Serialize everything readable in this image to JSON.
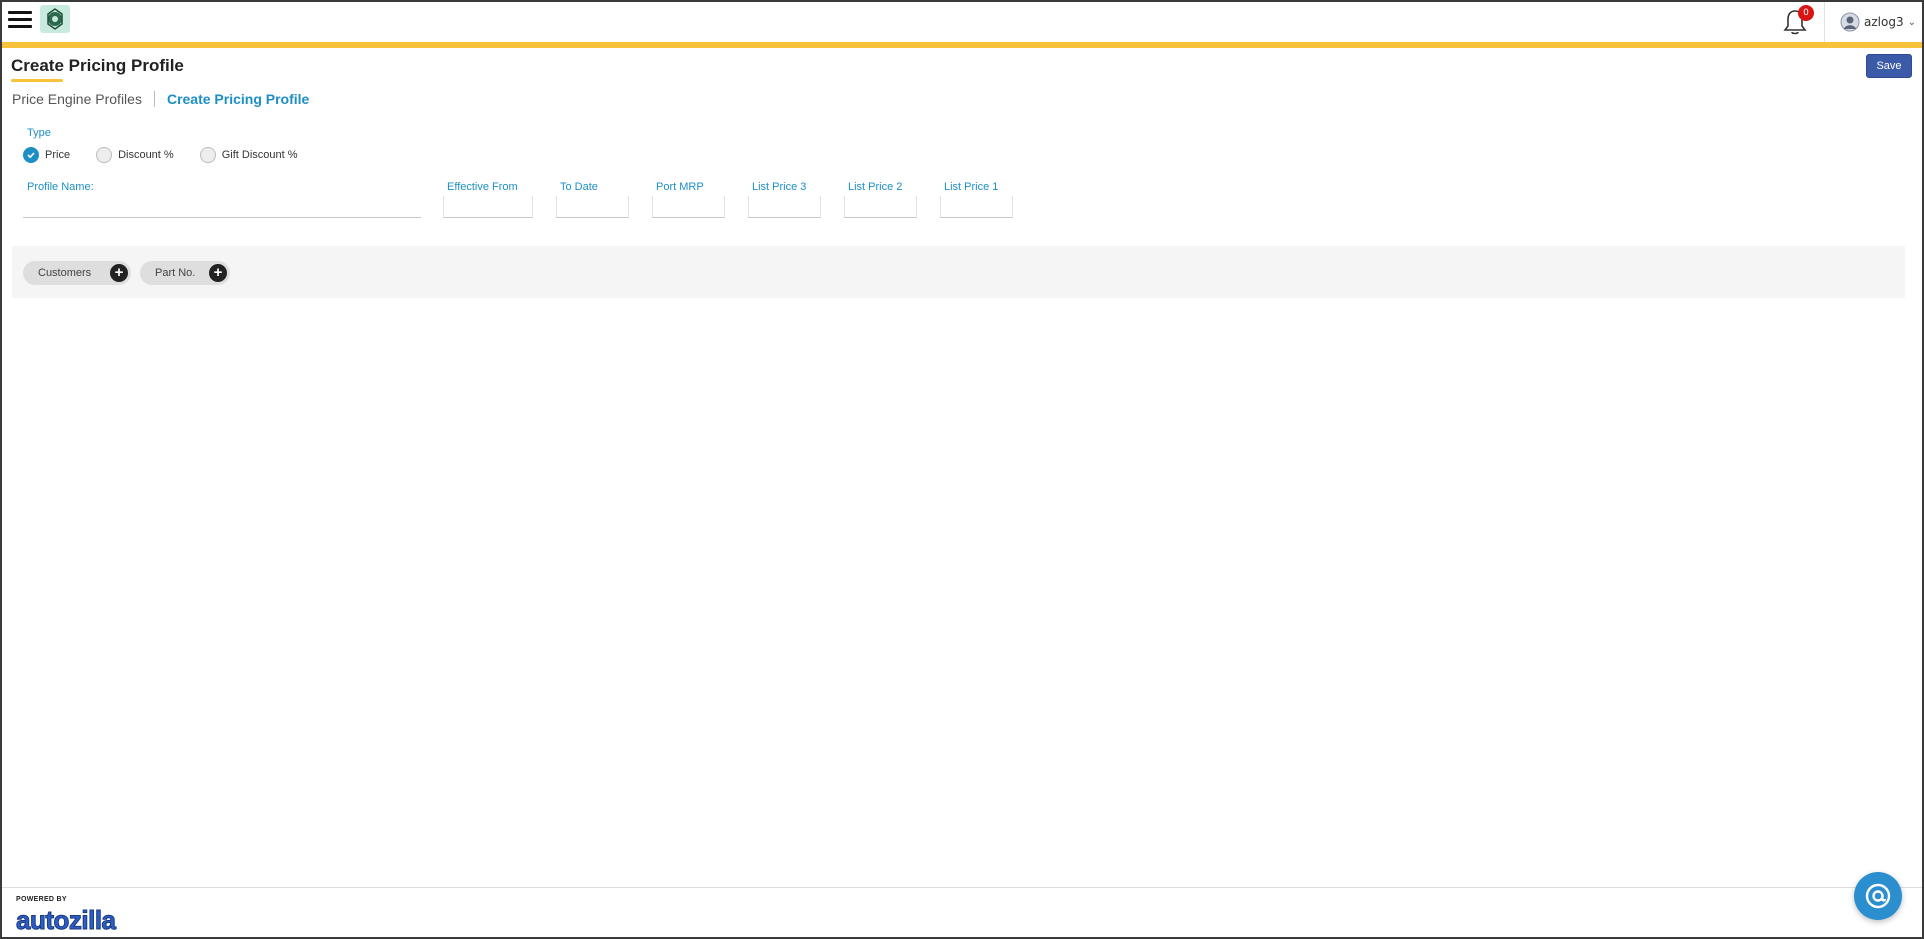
{
  "header": {
    "notification_count": "0",
    "username": "azlog3",
    "username_chevron": "⌄"
  },
  "page": {
    "title": "Create Pricing Profile",
    "save_label": "Save"
  },
  "breadcrumb": {
    "parent": "Price Engine Profiles",
    "current": "Create Pricing Profile"
  },
  "type_section": {
    "label": "Type",
    "options": [
      {
        "label": "Price",
        "checked": true
      },
      {
        "label": "Discount %",
        "checked": false
      },
      {
        "label": "Gift Discount %",
        "checked": false
      }
    ]
  },
  "fields": {
    "profile_name": {
      "label": "Profile Name:",
      "value": ""
    },
    "effective_from": {
      "label": "Effective From",
      "value": ""
    },
    "to_date": {
      "label": "To Date",
      "value": ""
    },
    "port_mrp": {
      "label": "Port MRP",
      "value": ""
    },
    "list_price_3": {
      "label": "List Price 3",
      "value": ""
    },
    "list_price_2": {
      "label": "List Price 2",
      "value": ""
    },
    "list_price_1": {
      "label": "List Price 1",
      "value": ""
    }
  },
  "chips": {
    "customers": "Customers",
    "part_no": "Part No.",
    "add_symbol": "+"
  },
  "footer": {
    "powered_by": "POWERED BY",
    "brand": "autozilla"
  },
  "colors": {
    "accent_blue": "#1d8fc5",
    "header_stripe": "#f7c33a",
    "save_button": "#3b5aa8",
    "badge_red": "#d91414"
  }
}
